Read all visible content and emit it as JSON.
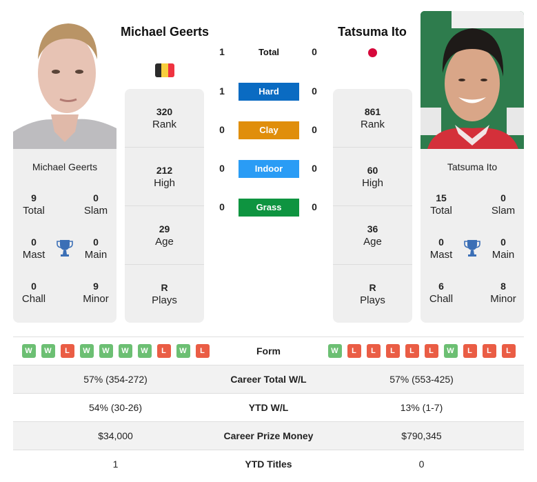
{
  "player1": {
    "name_heading": "Michael Geerts",
    "name": "Michael Geerts",
    "country": "Belgium",
    "flag_colors": [
      "#2b2b2b",
      "#f7cf3d",
      "#ef3340"
    ],
    "rank": "320",
    "rank_label": "Rank",
    "high": "212",
    "high_label": "High",
    "age": "29",
    "age_label": "Age",
    "plays": "R",
    "plays_label": "Plays",
    "titles": {
      "total": "9",
      "total_label": "Total",
      "slam": "0",
      "slam_label": "Slam",
      "mast": "0",
      "mast_label": "Mast",
      "main": "0",
      "main_label": "Main",
      "chall": "0",
      "chall_label": "Chall",
      "minor": "9",
      "minor_label": "Minor"
    },
    "form": [
      "W",
      "W",
      "L",
      "W",
      "W",
      "W",
      "W",
      "L",
      "W",
      "L"
    ],
    "career_wl": "57% (354-272)",
    "ytd_wl": "54% (30-26)",
    "prize_money": "$34,000",
    "ytd_titles": "1"
  },
  "player2": {
    "name_heading": "Tatsuma Ito",
    "name": "Tatsuma Ito",
    "country": "Japan",
    "flag_color": "#d6083b",
    "rank": "861",
    "rank_label": "Rank",
    "high": "60",
    "high_label": "High",
    "age": "36",
    "age_label": "Age",
    "plays": "R",
    "plays_label": "Plays",
    "titles": {
      "total": "15",
      "total_label": "Total",
      "slam": "0",
      "slam_label": "Slam",
      "mast": "0",
      "mast_label": "Mast",
      "main": "0",
      "main_label": "Main",
      "chall": "6",
      "chall_label": "Chall",
      "minor": "8",
      "minor_label": "Minor"
    },
    "form": [
      "W",
      "L",
      "L",
      "L",
      "L",
      "L",
      "W",
      "L",
      "L",
      "L"
    ],
    "career_wl": "57% (553-425)",
    "ytd_wl": "13% (1-7)",
    "prize_money": "$790,345",
    "ytd_titles": "0"
  },
  "h2h": [
    {
      "label": "Total",
      "left": "1",
      "right": "0",
      "color": ""
    },
    {
      "label": "Hard",
      "left": "1",
      "right": "0",
      "color": "#0a6bc2"
    },
    {
      "label": "Clay",
      "left": "0",
      "right": "0",
      "color": "#e08e0b"
    },
    {
      "label": "Indoor",
      "left": "0",
      "right": "0",
      "color": "#2a9cf5"
    },
    {
      "label": "Grass",
      "left": "0",
      "right": "0",
      "color": "#0e9440"
    }
  ],
  "table_labels": {
    "form": "Form",
    "career_wl": "Career Total W/L",
    "ytd_wl": "YTD W/L",
    "prize_money": "Career Prize Money",
    "ytd_titles": "YTD Titles"
  },
  "trophy_color": "#3b6fb6"
}
